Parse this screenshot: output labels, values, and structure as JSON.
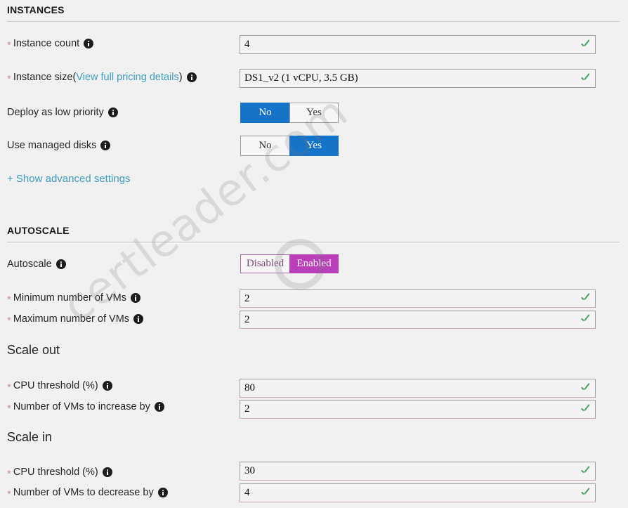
{
  "watermark": {
    "text": "certleader.com"
  },
  "sections": {
    "instances": {
      "title": "INSTANCES",
      "fields": {
        "instance_count": {
          "label": "Instance count",
          "required": true,
          "value": "4",
          "validated": true
        },
        "instance_size": {
          "label_prefix": "Instance size",
          "link_text": "View full pricing details",
          "paren_open": "(",
          "paren_close": ")",
          "required": true,
          "value": "DS1_v2 (1 vCPU, 3.5 GB)",
          "validated": true
        },
        "deploy_low_priority": {
          "label": "Deploy as low priority",
          "required": false,
          "options": [
            "No",
            "Yes"
          ],
          "selected": "No"
        },
        "use_managed_disks": {
          "label": "Use managed disks",
          "required": false,
          "options": [
            "No",
            "Yes"
          ],
          "selected": "Yes"
        }
      },
      "advanced_link": "+ Show advanced settings"
    },
    "autoscale": {
      "title": "AUTOSCALE",
      "fields": {
        "autoscale": {
          "label": "Autoscale",
          "required": false,
          "options": [
            "Disabled",
            "Enabled"
          ],
          "selected": "Enabled"
        },
        "min_vms": {
          "label": "Minimum number of VMs",
          "required": true,
          "value": "2",
          "validated": true
        },
        "max_vms": {
          "label": "Maximum number of VMs",
          "required": true,
          "value": "2",
          "validated": true
        }
      },
      "scale_out": {
        "heading": "Scale out",
        "cpu_threshold": {
          "label": "CPU threshold (%)",
          "required": true,
          "value": "80",
          "validated": true
        },
        "vm_increase": {
          "label": "Number of VMs to increase by",
          "required": true,
          "value": "2",
          "validated": true
        }
      },
      "scale_in": {
        "heading": "Scale in",
        "cpu_threshold": {
          "label": "CPU threshold (%)",
          "required": true,
          "value": "30",
          "validated": true
        },
        "vm_decrease": {
          "label": "Number of VMs to decrease by",
          "required": true,
          "value": "4",
          "validated": true
        }
      }
    }
  },
  "colors": {
    "toggle_selected_blue": "#1573c8",
    "toggle_selected_purple": "#bb3ebb",
    "link_blue": "#3f9dc0",
    "validation_green": "#4aa35a",
    "required_star": "#d08a9a",
    "page_background": "#f1f1f1"
  }
}
